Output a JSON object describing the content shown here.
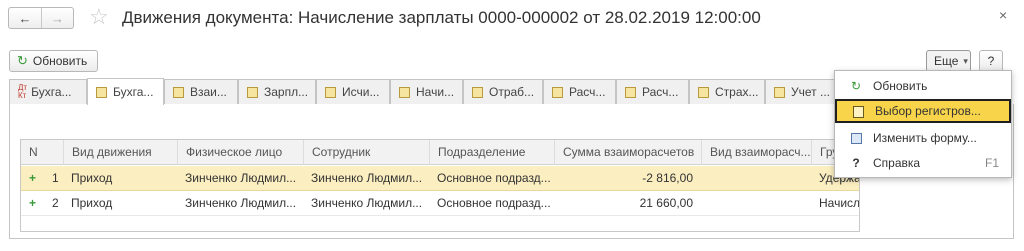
{
  "window": {
    "title": "Движения документа: Начисление зарплаты 0000-000002 от 28.02.2019 12:00:00",
    "close_glyph": "×"
  },
  "nav": {
    "back": "←",
    "forward": "→",
    "favorite": "☆"
  },
  "toolbar": {
    "refresh_label": "Обновить",
    "more_label": "Еще",
    "more_arrow": "▾",
    "help_label": "?"
  },
  "tabs": [
    {
      "label": "Бухга...",
      "icon": "dt-kt-icon",
      "active": false
    },
    {
      "label": "Бухга...",
      "icon": "register-icon",
      "active": true
    },
    {
      "label": "Взаи...",
      "icon": "register-icon",
      "active": false
    },
    {
      "label": "Зарпл...",
      "icon": "register-icon",
      "active": false
    },
    {
      "label": "Исчи...",
      "icon": "register-icon",
      "active": false
    },
    {
      "label": "Начи...",
      "icon": "register-icon",
      "active": false
    },
    {
      "label": "Отраб...",
      "icon": "register-icon",
      "active": false
    },
    {
      "label": "Расч...",
      "icon": "register-icon",
      "active": false
    },
    {
      "label": "Расч...",
      "icon": "register-icon",
      "active": false
    },
    {
      "label": "Страх...",
      "icon": "register-icon",
      "active": false
    },
    {
      "label": "Учет ...",
      "icon": "register-icon",
      "active": false
    }
  ],
  "dt_kt_text": {
    "dt": "Дт",
    "kt": "Кт"
  },
  "table": {
    "columns": [
      "N",
      "Вид движения",
      "Физическое лицо",
      "Сотрудник",
      "Подразделение",
      "Сумма взаиморасчетов",
      "Вид взаиморасч...",
      "Гру"
    ],
    "rows": [
      {
        "sign": "+",
        "n": "1",
        "kind": "Приход",
        "person": "Зинченко Людмил...",
        "employee": "Зинченко Людмил...",
        "division": "Основное подразд...",
        "amount": "-2 816,00",
        "settlement_type": "",
        "group": "Удержано"
      },
      {
        "sign": "+",
        "n": "2",
        "kind": "Приход",
        "person": "Зинченко Людмил...",
        "employee": "Зинченко Людмил...",
        "division": "Основное подразд...",
        "amount": "21 660,00",
        "settlement_type": "",
        "group": "Начислено"
      }
    ]
  },
  "menu": {
    "items": [
      {
        "label": "Обновить",
        "icon": "refresh-icon",
        "shortcut": ""
      },
      {
        "label": "Выбор регистров...",
        "icon": "registers-icon",
        "shortcut": "",
        "highlighted": true
      },
      {
        "label": "Изменить форму...",
        "icon": "form-settings-icon",
        "shortcut": ""
      },
      {
        "label": "Справка",
        "icon": "help-icon",
        "shortcut": "F1"
      }
    ]
  },
  "colors": {
    "accent_green": "#3a9a3a",
    "selected_row": "#fbeec1",
    "menu_highlight": "#f7d44a"
  }
}
